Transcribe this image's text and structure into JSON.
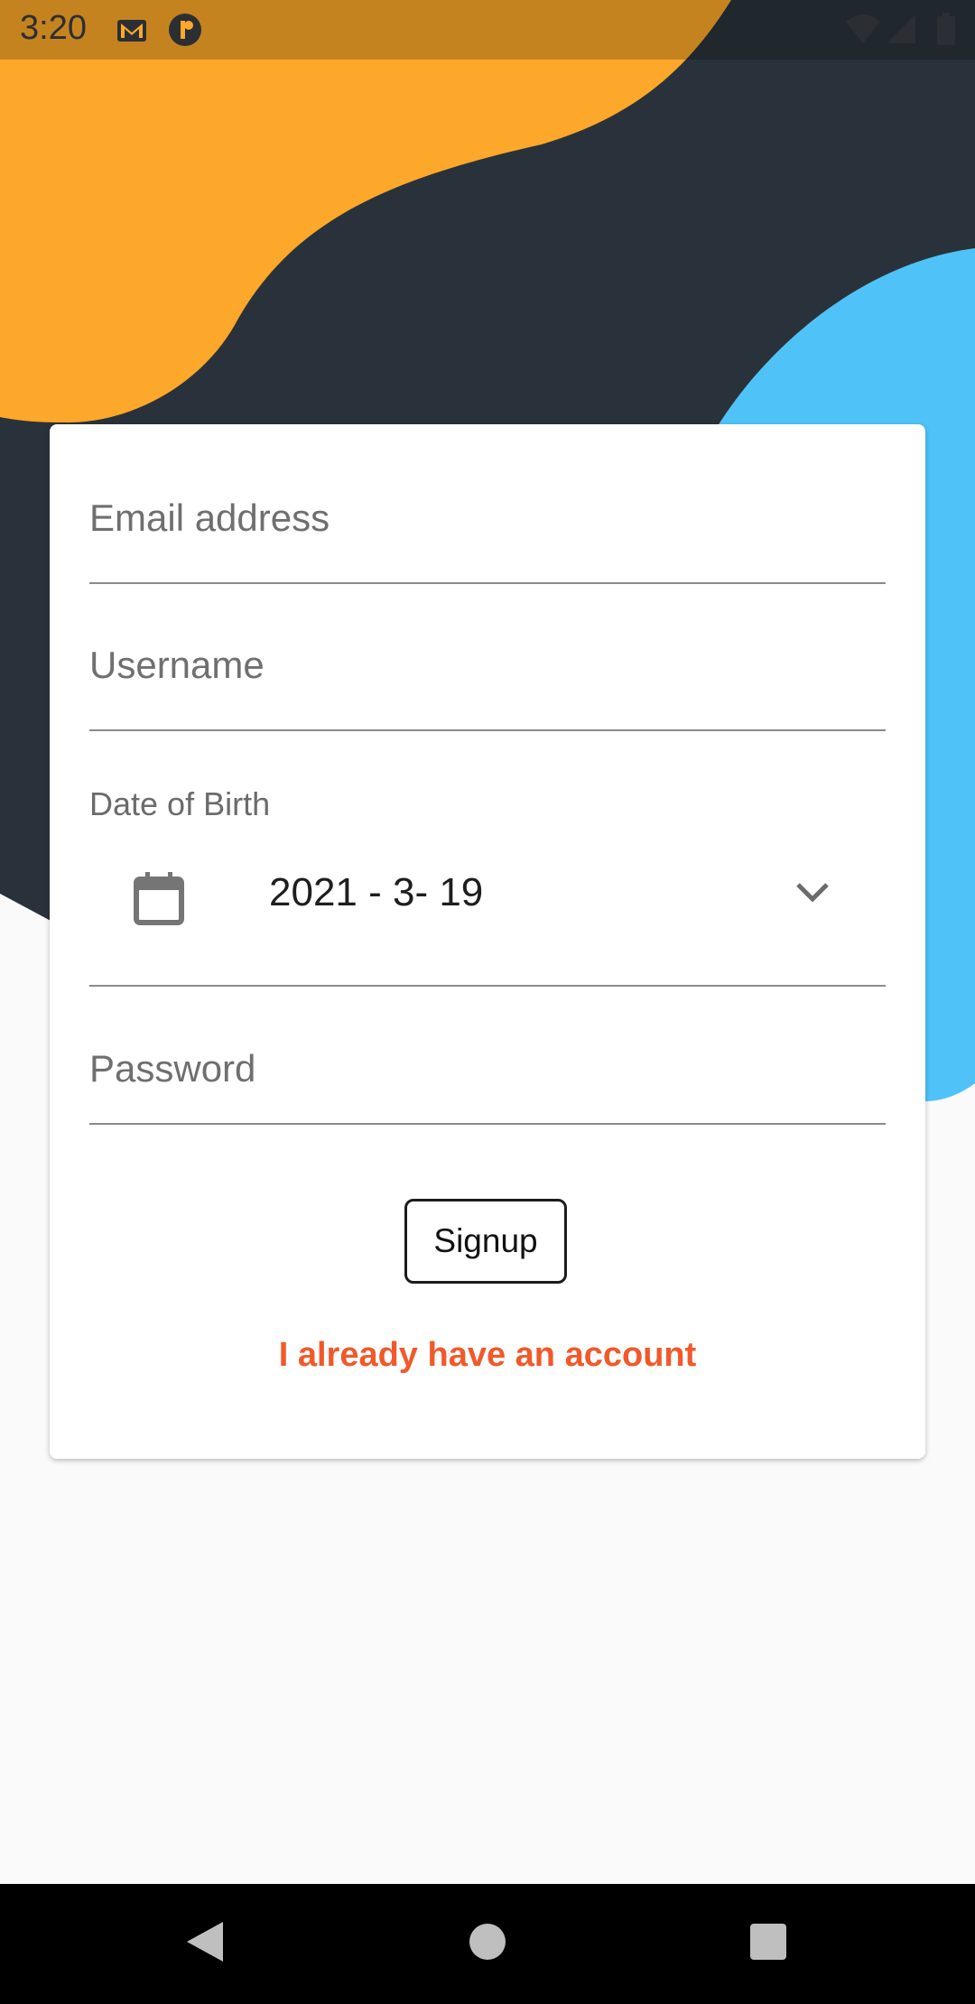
{
  "status_bar": {
    "time": "3:20",
    "icons_left": [
      "gmail-icon",
      "app-notification-icon"
    ],
    "icons_right": [
      "wifi-icon",
      "signal-icon",
      "battery-icon"
    ]
  },
  "colors": {
    "orange_blob": "#FDA82A",
    "dark_blob": "#29323A",
    "blue_blob": "#4FC3F7",
    "link_color": "#F1592A",
    "background": "#FAFAFA"
  },
  "form": {
    "email_placeholder": "Email address",
    "username_placeholder": "Username",
    "dob_label": "Date of Birth",
    "dob_value": "2021 - 3- 19",
    "password_placeholder": "Password",
    "signup_label": "Signup",
    "login_link": "I already have an account"
  },
  "nav_bar": {
    "buttons": [
      "back-icon",
      "home-icon",
      "recents-icon"
    ]
  }
}
